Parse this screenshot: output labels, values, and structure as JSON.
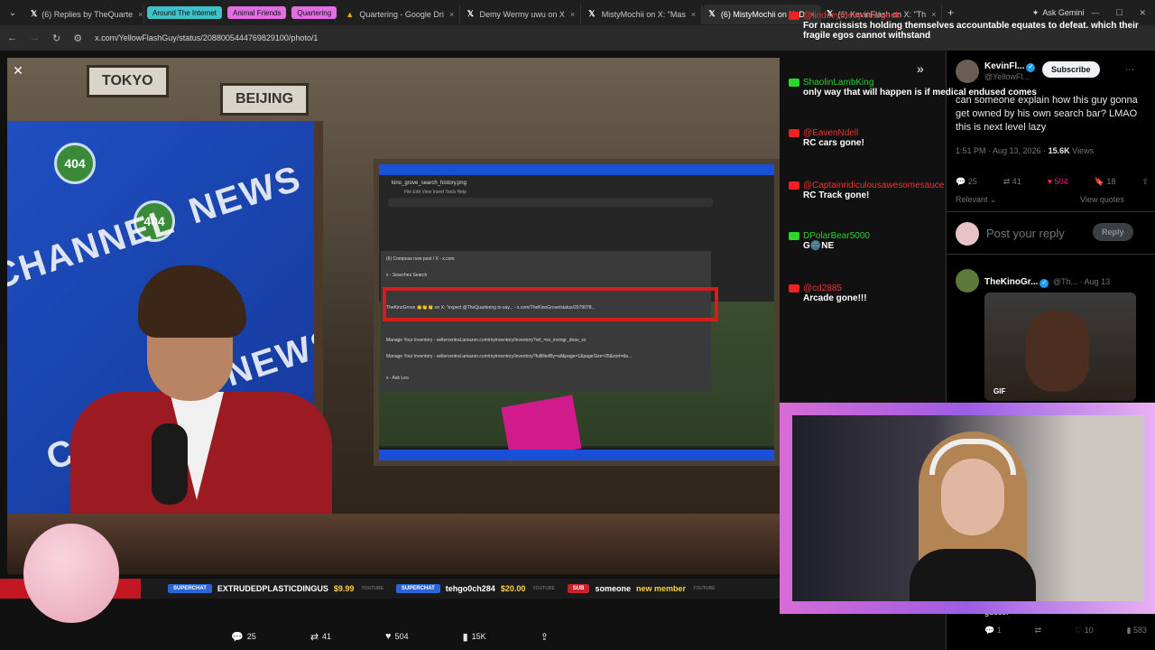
{
  "browser": {
    "tabs": [
      {
        "label": "(6) Replies by TheQuarte",
        "icon": "x-logo-icon"
      },
      {
        "label": "Around The Internet",
        "chip": true,
        "color": "#3fc1c9"
      },
      {
        "label": "Animal Friends",
        "chip": true,
        "color": "#e36de3"
      },
      {
        "label": "Quartering",
        "chip": true,
        "color": "#e36de3"
      },
      {
        "label": "Quartering - Google Dri",
        "icon": "google-drive-icon"
      },
      {
        "label": "Demy Wermy uwu on X",
        "icon": "x-logo-icon"
      },
      {
        "label": "MistyMochii on X: \"Mas",
        "icon": "x-logo-icon"
      },
      {
        "label": "(6) MistyMochii on X: D",
        "icon": "x-logo-icon",
        "active": true
      },
      {
        "label": "(6) KevinFlash on X: \"Th",
        "icon": "x-logo-icon"
      }
    ],
    "ask_gemini": "Ask Gemini",
    "url": "x.com/YellowFlashGuy/status/2088005444769829100/photo/1"
  },
  "stream": {
    "signs": [
      "TOKYO",
      "BEIJING"
    ],
    "logo": "404",
    "wall_text": [
      "CHANNEL",
      "NEWS"
    ],
    "monitor": {
      "title": "kino_grove_search_history.png",
      "menu": "File  Edit  View  Insert  Tools  Help",
      "rows": [
        "(6) Compose new post / X - x.com",
        "x - Searches Search",
        "TheKinoGrove 👏👏👏 on X: \"expect @TheQuartering to say... - x.com/TheKinoGrove/status/2079078...",
        "Manage Your Inventory - sellercentral.amazon.com/myinventory/inventory?ref_=xx_invmgr_dnav_xx",
        "Manage Your Inventory - sellercentral.amazon.com/myinventory/inventory?fulfilledBy=all&page=1&pageSize=25&sort=da...",
        "x - Ask Leo"
      ]
    },
    "chat": [
      {
        "user": "@lindseythecynicalgeek",
        "text": "For narcissists holding themselves accountable equates to defeat. which their fragile egos cannot withstand",
        "src": "yt"
      },
      {
        "user": "ShaolinLambKing",
        "text": "only way that will happen is if medical endused comes",
        "src": "rb"
      },
      {
        "user": "@EavenNdell",
        "text": "RC cars gone!",
        "src": "yt"
      },
      {
        "user": "@Captainridiculousawesomesauce",
        "text": "RC Track gone!",
        "src": "yt"
      },
      {
        "user": "DPolarBear5000",
        "text": "G🌚NE",
        "src": "rb"
      },
      {
        "user": "@cd2885",
        "text": "Arcade gone!!!",
        "src": "yt"
      }
    ],
    "ticker": [
      {
        "type": "SUPERCHAT",
        "name": "EXTRUDEDPLASTICDINGUS",
        "amount": "$9.99",
        "src": "YOUTUBE"
      },
      {
        "type": "SUPERCHAT",
        "name": "tehgo0ch284",
        "amount": "$20.00",
        "src": "YOUTUBE"
      },
      {
        "type": "SUB",
        "name": "someone",
        "amount": "new member",
        "src": "YOUTUBE"
      }
    ]
  },
  "photo_footer": {
    "replies": "25",
    "reposts": "41",
    "likes": "504",
    "views": "15K"
  },
  "sidebar": {
    "author_name": "KevinFl...",
    "author_handle": "@YellowFl...",
    "subscribe": "Subscribe",
    "tweet": "can someone explain how this guy gonna get owned by his own search bar? LMAO this is next level lazy",
    "time": "1:51 PM · Aug 13, 2026 ·",
    "views_count": "15.6K",
    "views_label": "Views",
    "stats": {
      "replies": "25",
      "reposts": "41",
      "likes": "504",
      "bookmarks": "18"
    },
    "relevant": "Relevant",
    "view_quotes": "View quotes",
    "reply_placeholder": "Post your reply",
    "reply_button": "Reply",
    "reply2_name": "TheKinoGr...",
    "reply2_handle": "@Th... · Aug 13",
    "gif_label": "GIF",
    "guess": "guess.",
    "reply2_stats": {
      "replies": "1",
      "likes": "10",
      "views": "583"
    }
  }
}
